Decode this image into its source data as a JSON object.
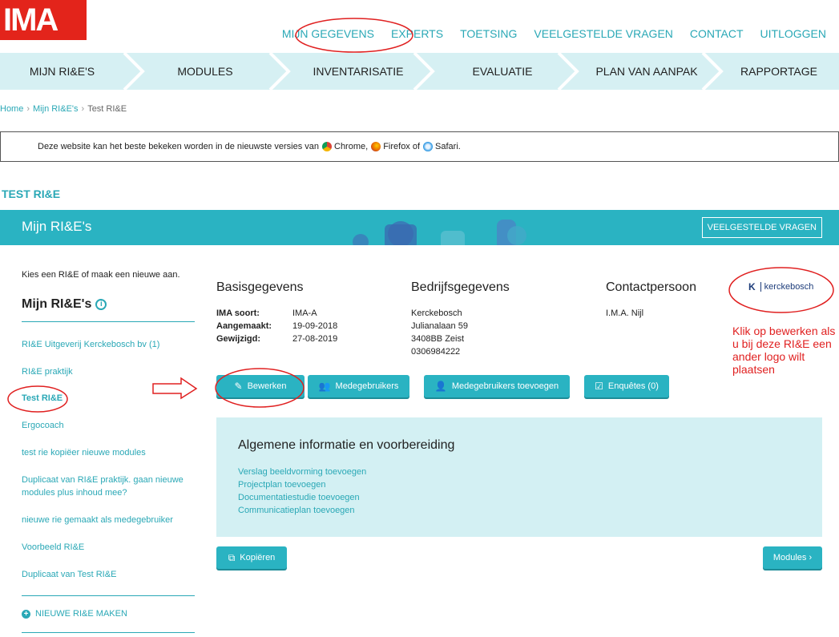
{
  "header": {
    "logo_text": "IMA",
    "nav": [
      "MIJN GEGEVENS",
      "EXPERTS",
      "TOETSING",
      "VEELGESTELDE VRAGEN",
      "CONTACT",
      "UITLOGGEN"
    ]
  },
  "steps": [
    "MIJN RI&E'S",
    "MODULES",
    "INVENTARISATIE",
    "EVALUATIE",
    "PLAN VAN AANPAK",
    "RAPPORTAGE"
  ],
  "breadcrumb": {
    "home": "Home",
    "mijn": "Mijn RI&E's",
    "current": "Test RI&E"
  },
  "notice": {
    "text": "Deze website kan het beste bekeken worden in de nieuwste versies van",
    "chrome": "Chrome,",
    "firefox": "Firefox of",
    "safari": "Safari."
  },
  "page_title": "TEST RI&E",
  "banner": {
    "title": "Mijn RI&E's",
    "faq_button": "VEELGESTELDE VRAGEN"
  },
  "sidebar": {
    "intro": "Kies een RI&E of maak een nieuwe aan.",
    "heading": "Mijn RI&E's",
    "items": [
      "RI&E Uitgeverij Kerckebosch bv (1)",
      "RI&E praktijk",
      "Test RI&E",
      "Ergocoach",
      "test rie kopiëer nieuwe modules",
      "Duplicaat van RI&E praktijk. gaan nieuwe modules plus inhoud mee?",
      "nieuwe rie gemaakt als medegebruiker",
      "Voorbeeld RI&E",
      "Duplicaat van Test RI&E"
    ],
    "new_label": "NIEUWE RI&E MAKEN"
  },
  "basis": {
    "title": "Basisgegevens",
    "rows": [
      {
        "k": "IMA soort:",
        "v": "IMA-A"
      },
      {
        "k": "Aangemaakt:",
        "v": "19-09-2018"
      },
      {
        "k": "Gewijzigd:",
        "v": "27-08-2019"
      }
    ]
  },
  "bedrijf": {
    "title": "Bedrijfsgegevens",
    "lines": [
      "Kerckebosch",
      "Julianalaan 59",
      "3408BB Zeist",
      "0306984222"
    ]
  },
  "contact": {
    "title": "Contactpersoon",
    "name": "I.M.A. Nijl"
  },
  "company_logo": {
    "mark": "K",
    "text": "kerckebosch"
  },
  "annotation": "Klik op bewerken als u bij deze RI&E een ander logo wilt plaatsen",
  "buttons": {
    "edit": "Bewerken",
    "users": "Medegebruikers",
    "add_users": "Medegebruikers toevoegen",
    "surveys": "Enquêtes (0)",
    "copy": "Kopiëren",
    "modules": "Modules ›"
  },
  "panel": {
    "title": "Algemene informatie en voorbereiding",
    "links": [
      "Verslag beeldvorming toevoegen",
      "Projectplan toevoegen",
      "Documentatiestudie toevoegen",
      "Communicatieplan toevoegen"
    ]
  },
  "colors": {
    "accent": "#2ab3c2",
    "light": "#d6f0f3",
    "annotation": "#e02020",
    "logo": "#e3241b"
  }
}
